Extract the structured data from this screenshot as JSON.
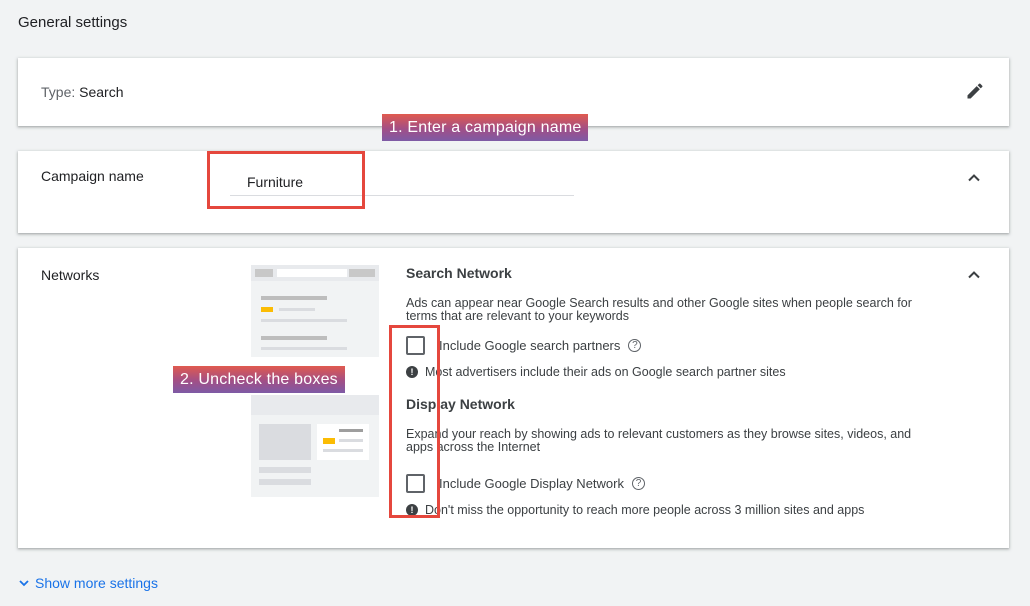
{
  "page": {
    "title": "General settings"
  },
  "type_card": {
    "label": "Type:",
    "value": "Search"
  },
  "name_card": {
    "label": "Campaign name",
    "value": "Furniture"
  },
  "networks_card": {
    "label": "Networks",
    "search": {
      "title": "Search Network",
      "desc_line1": "Ads can appear near Google Search results and other Google sites when people search for",
      "desc_line2": "terms that are relevant to your keywords",
      "checkbox_label": "Include Google search partners",
      "checked": false,
      "note": "Most advertisers include their ads on Google search partner sites"
    },
    "display": {
      "title": "Display Network",
      "desc_line1": "Expand your reach by showing ads to relevant customers as they browse sites, videos, and",
      "desc_line2": "apps across the Internet",
      "checkbox_label": "Include Google Display Network",
      "checked": false,
      "note": "Don't miss the opportunity to reach more people across 3 million sites and apps"
    }
  },
  "footer": {
    "show_more": "Show more settings"
  },
  "annotations": {
    "step1": "1.  Enter a campaign name",
    "step2": "2. Uncheck the boxes"
  },
  "colors": {
    "accent": "#1a73e8",
    "highlight": "#e5473d",
    "yellow": "#fbbc04"
  },
  "icons": [
    "pencil-edit-icon",
    "chevron-up-icon",
    "help-circle-icon",
    "info-filled-icon",
    "chevron-down-icon"
  ]
}
